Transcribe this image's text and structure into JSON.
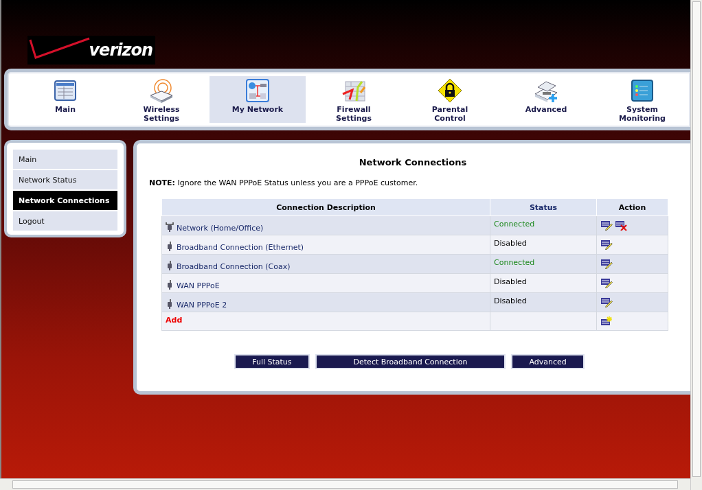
{
  "logo": {
    "text": "verizon"
  },
  "nav": [
    {
      "label": "Main",
      "kind": "main",
      "selected": false
    },
    {
      "label": "Wireless Settings",
      "kind": "wireless",
      "selected": false
    },
    {
      "label": "My Network",
      "kind": "network",
      "selected": true
    },
    {
      "label": "Firewall Settings",
      "kind": "firewall",
      "selected": false
    },
    {
      "label": "Parental Control",
      "kind": "parental",
      "selected": false
    },
    {
      "label": "Advanced",
      "kind": "advanced",
      "selected": false
    },
    {
      "label": "System Monitoring",
      "kind": "monitoring",
      "selected": false
    }
  ],
  "sidebar": {
    "items": [
      {
        "label": "Main",
        "selected": false
      },
      {
        "label": "Network Status",
        "selected": false
      },
      {
        "label": "Network Connections",
        "selected": true
      },
      {
        "label": "Logout",
        "selected": false
      }
    ]
  },
  "content": {
    "title": "Network Connections",
    "note": "**NOTE:** Ignore the WAN PPPoE Status unless you are a PPPoE customer.",
    "table": {
      "columns": [
        "Connection Description",
        "Status",
        "Action"
      ],
      "rows": [
        {
          "kind": "lan",
          "name": "Network (Home/Office)",
          "status": "Connected",
          "connected": true,
          "actions": [
            {
              "kind": "edit"
            },
            {
              "kind": "delete"
            }
          ]
        },
        {
          "kind": "wan",
          "name": "Broadband Connection (Ethernet)",
          "status": "Disabled",
          "connected": false,
          "actions": [
            {
              "kind": "edit"
            }
          ]
        },
        {
          "kind": "wan",
          "name": "Broadband Connection (Coax)",
          "status": "Connected",
          "connected": true,
          "actions": [
            {
              "kind": "edit"
            }
          ]
        },
        {
          "kind": "wan",
          "name": "WAN PPPoE",
          "status": "Disabled",
          "connected": false,
          "actions": [
            {
              "kind": "edit"
            }
          ]
        },
        {
          "kind": "wan",
          "name": "WAN PPPoE 2",
          "status": "Disabled",
          "connected": false,
          "actions": [
            {
              "kind": "edit"
            }
          ]
        }
      ],
      "add_row": {
        "label": "Add",
        "actions": [
          {
            "kind": "add"
          }
        ]
      }
    },
    "buttons": [
      "Full Status",
      "Detect Broadband Connection",
      "Advanced"
    ]
  }
}
